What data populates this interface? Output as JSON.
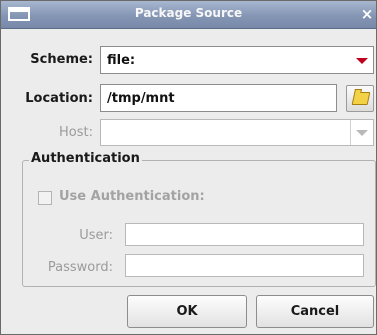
{
  "window": {
    "title": "Package Source",
    "close_glyph": "×"
  },
  "form": {
    "scheme": {
      "label": "Scheme:",
      "value": "file:"
    },
    "location": {
      "label": "Location:",
      "value": "/tmp/mnt"
    },
    "host": {
      "label": "Host:",
      "value": ""
    },
    "authentication": {
      "title": "Authentication",
      "use_label": "Use Authentication:",
      "use_checked": false,
      "user": {
        "label": "User:",
        "value": ""
      },
      "password": {
        "label": "Password:",
        "value": ""
      }
    }
  },
  "buttons": {
    "ok_label": "OK",
    "cancel_label": "Cancel"
  },
  "colors": {
    "dropdown_arrow_active": "#c0001f",
    "dropdown_arrow_disabled": "#b9b9b9"
  }
}
